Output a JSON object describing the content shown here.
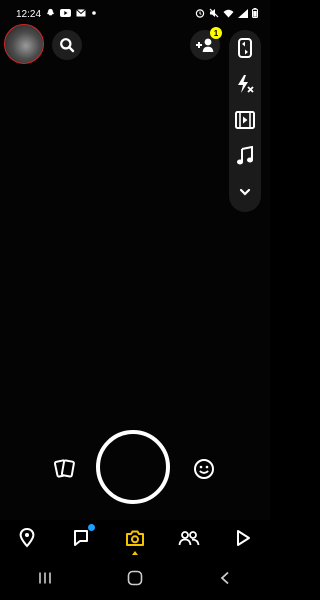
{
  "status_bar": {
    "time": "12:24",
    "icons_left": [
      "snapchat-ghost-icon",
      "youtube-icon",
      "mail-icon",
      "dot-icon"
    ],
    "icons_right": [
      "alarm-icon",
      "mute-icon",
      "wifi-icon",
      "signal-icon",
      "battery-icon"
    ]
  },
  "header": {
    "avatar": "avatar",
    "search_icon": "search-icon",
    "add_friend_icon": "add-friend-icon",
    "notification_badge": "1"
  },
  "camera_toolbar": {
    "items": [
      "flip-camera-icon",
      "flash-off-icon",
      "video-effects-icon",
      "music-icon",
      "chevron-down-icon"
    ]
  },
  "capture_row": {
    "left_icon": "memories-icon",
    "right_icon": "lens-smiley-icon"
  },
  "bottom_nav": {
    "items": [
      "map-icon",
      "chat-icon",
      "camera-icon",
      "stories-icon",
      "spotlight-icon"
    ],
    "active": "camera-icon",
    "active_color": "#f5c400",
    "chat_dot_color": "#1fa0ff"
  },
  "system_nav": {
    "items": [
      "recent-apps-icon",
      "home-icon",
      "back-icon"
    ]
  }
}
